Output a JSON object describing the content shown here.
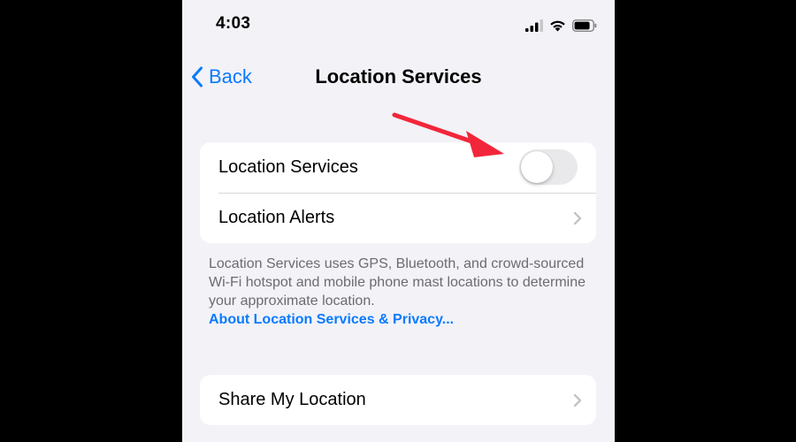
{
  "status_bar": {
    "time": "4:03",
    "icons": [
      "cellular-signal-icon",
      "wifi-icon",
      "battery-icon"
    ]
  },
  "nav": {
    "back_label": "Back",
    "title": "Location Services"
  },
  "settings_group_1": {
    "rows": [
      {
        "label": "Location Services",
        "control": "toggle",
        "toggle_on": false
      },
      {
        "label": "Location Alerts",
        "control": "chevron"
      }
    ]
  },
  "footer": {
    "description": "Location Services uses GPS, Bluetooth, and crowd-sourced Wi-Fi hotspot and mobile phone mast locations to determine your approximate location.",
    "link": "About Location Services & Privacy..."
  },
  "settings_group_2": {
    "rows": [
      {
        "label": "Share My Location",
        "control": "chevron"
      }
    ]
  },
  "colors": {
    "accent": "#0a7aff",
    "background": "#f2f2f7",
    "annotation_arrow": "#f2263a",
    "toggle_off": "#e9e9eb"
  }
}
